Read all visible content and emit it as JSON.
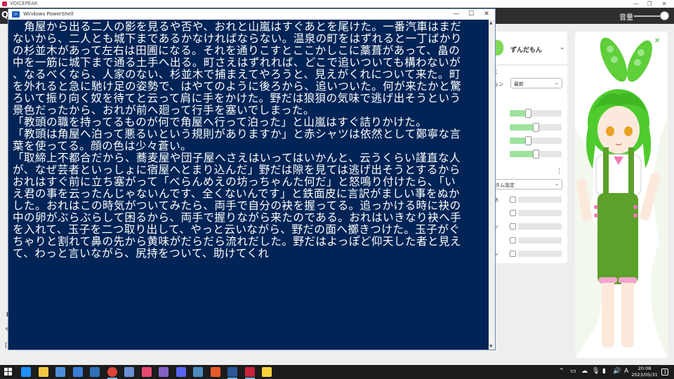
{
  "voicepeak": {
    "window_title": "VOICEPEAK",
    "app_letter": "Q",
    "volume_label": "音量",
    "character_name": "ずんだもん",
    "style_label_fragment": "ョン",
    "style_fragment_top": "く",
    "style_value": "最新",
    "custom_select_value": "タム設定",
    "row_fragments": [
      "あ",
      "ン",
      "ン"
    ],
    "menu_dots": "⋮",
    "slider_levels": [
      0.35,
      0.5,
      0.35,
      0.5
    ],
    "portrait_close": "✕"
  },
  "powershell": {
    "window_title": "Windows PowerShell",
    "minimize": "—",
    "maximize": "☐",
    "close": "✕",
    "console_lines": [
      "　角屋から出る二人の影を見るや否や、おれと山嵐はすぐあとを尾けた。一番汽車はまだ",
      "ないから、二人とも城下まであるかなければならない。温泉の町をはずれると一丁ばかり",
      "の杉並木があって左右は田圃になる。それを通りこすとここかしこに藁葺があって、畠の",
      "中を一筋に城下まで通る土手へ出る。町さえはずれれば、どこで追いついても構わないが",
      "、なるべくなら、人家のない、杉並木で捕まえてやろうと、見えがくれについて来た。町",
      "を外れると急に馳け足の姿勢で、はやてのように後ろから、追いついた。何が来たかと驚",
      "ろいて振り向く奴を待てと云って肩に手をかけた。野だは狼狽の気味で逃げ出そうという",
      "景色だったから、おれが前へ廻って行手を塞いでしまった。",
      "「教頭の職を持ってるものが何で角屋へ行って泊った」と山嵐はすぐ詰りかけた。",
      "「教頭は角屋へ泊って悪るいという規則がありますか」と赤シャツは依然として鄭寧な言",
      "葉を使ってる。顔の色は少々蒼い。",
      "「取締上不都合だから、蕎麦屋や団子屋へさえはいってはいかんと、云うくらい謹直な人",
      "が、なぜ芸者といっしょに宿屋へとまり込んだ」野だは隙を見ては逃げ出そうとするから",
      "おれはすぐ前に立ち塞がって「べらんめえの坊っちゃんた何だ」と怒鳴り付けたら、「い",
      "え君の事を云ったんじゃないんです、全くないんです」と鉄面皮に言訳がましい事をぬか",
      "した。おれはこの時気がついてみたら、両手で自分の袂を握ってる。追っかける時に袂の",
      "中の卵がぶらぶらして困るから、両手で握りながら来たのである。おれはいきなり袂へ手",
      "を入れて、玉子を二つ取り出して、やっと云いながら、野だの面へ擲きつけた。玉子がぐ",
      "ちゃりと割れて鼻の先から黄味がだらだら流れだした。野だはよっぽど仰天した者と見え",
      "て、わっと言いながら、尻持をついて、助けてくれ"
    ]
  },
  "taskbar": {
    "tray_ime": "A",
    "clock_time": "20:08",
    "clock_date": "2023/05/31",
    "notification_count": "1",
    "icons": [
      "edge-icon",
      "explorer-icon",
      "calculator-icon",
      "mail-icon",
      "tv-icon",
      "chrome-icon",
      "app-icon",
      "music-icon",
      "visual-studio-icon",
      "discord-icon",
      "python-icon",
      "office-icon",
      "powershell-icon",
      "voicepeak-icon",
      "sticky-notes-icon"
    ]
  }
}
